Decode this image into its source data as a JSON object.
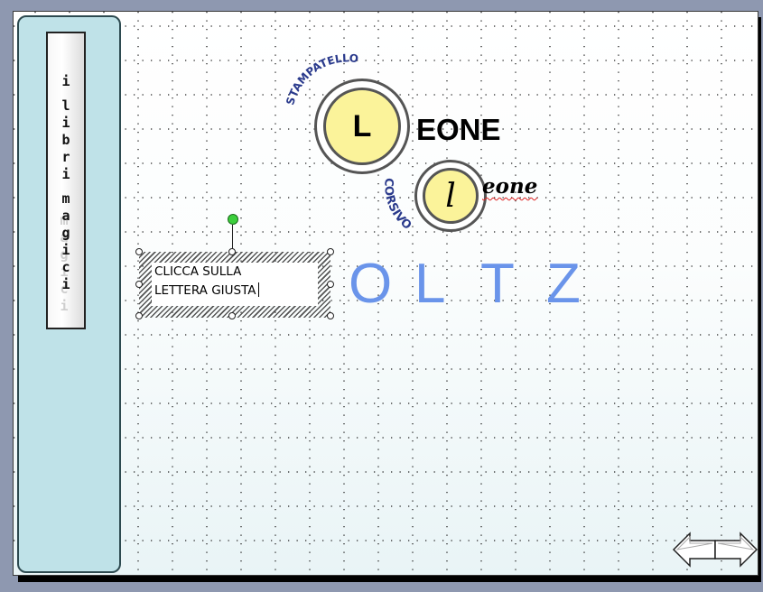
{
  "sidebar": {
    "banner_title": "i libri magici",
    "banner_letters": [
      "i",
      " ",
      "l",
      "i",
      "b",
      "r",
      "i",
      " ",
      "m",
      "a",
      "g",
      "i",
      "c",
      "i"
    ],
    "banner_ghost_text": "magici"
  },
  "logo": {
    "big_circle_letter": "L",
    "upper_word": "EONE",
    "arc_top_text": "STAMPATELLO",
    "small_circle_letter": "l",
    "lower_word": "eone",
    "arc_bottom_text": "CORSIVO"
  },
  "textbox": {
    "line1": "CLICCA SULLA",
    "line2": "LETTERA GIUSTA"
  },
  "letter_choices": [
    "O",
    "L",
    "T",
    "Z"
  ],
  "colors": {
    "slide_background": "#ffffff",
    "sidebar_fill": "#bfe2e8",
    "letter_choice_color": "#6a94ea",
    "circle_fill": "#fbf39a",
    "arc_text_color": "#2a3a8c",
    "rotation_handle": "#3ccf3c"
  },
  "icons": {
    "nav_back": "left-arrow-icon",
    "nav_forward": "right-arrow-icon",
    "rotation_handle": "rotation-handle-icon"
  }
}
